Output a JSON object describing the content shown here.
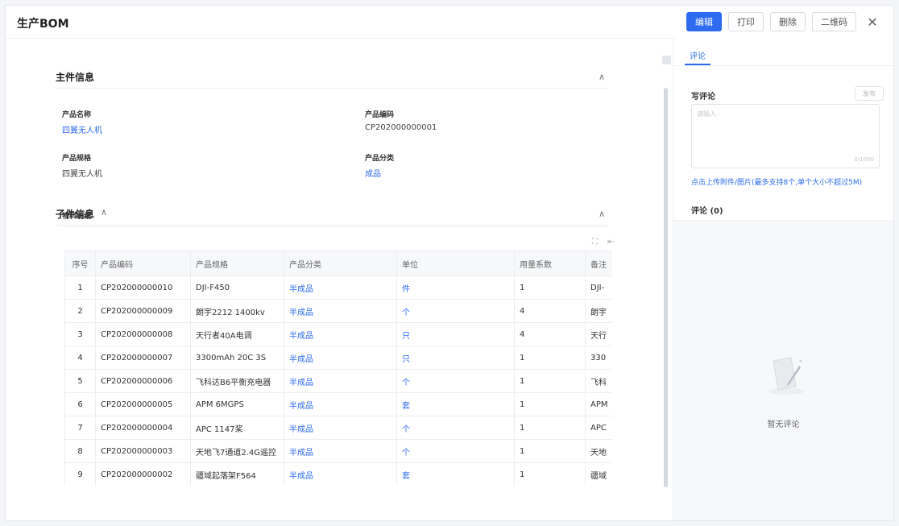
{
  "window": {
    "title": "生产BOM",
    "buttons": {
      "edit": "编辑",
      "print": "打印",
      "delete": "删除",
      "qrcode": "二维码"
    }
  },
  "main_info": {
    "title": "主件信息",
    "fields": {
      "product_name_label": "产品名称",
      "product_name": "四翼无人机",
      "product_code_label": "产品编码",
      "product_code": "CP202000000001",
      "product_spec_label": "产品规格",
      "product_spec": "四翼无人机",
      "product_category_label": "产品分类",
      "product_category": "成品"
    }
  },
  "sub_info": {
    "title": "子件信息",
    "subsection_title": "物料明细",
    "table": {
      "headers": [
        "序号",
        "产品编码",
        "产品规格",
        "产品分类",
        "单位",
        "用量系数",
        "备注"
      ],
      "rows": [
        [
          "1",
          "CP202000000010",
          "DJI-F450",
          "半成品",
          "件",
          "1",
          "DJI-"
        ],
        [
          "2",
          "CP202000000009",
          "朗宇2212 1400kv",
          "半成品",
          "个",
          "4",
          "朗宇"
        ],
        [
          "3",
          "CP202000000008",
          "天行者40A电调",
          "半成品",
          "只",
          "4",
          "天行"
        ],
        [
          "4",
          "CP202000000007",
          "3300mAh 20C 3S",
          "半成品",
          "只",
          "1",
          "330"
        ],
        [
          "5",
          "CP202000000006",
          "飞科达B6平衡充电器",
          "半成品",
          "个",
          "1",
          "飞科"
        ],
        [
          "6",
          "CP202000000005",
          "APM 6MGPS",
          "半成品",
          "套",
          "1",
          "APM"
        ],
        [
          "7",
          "CP202000000004",
          "APC 1147桨",
          "半成品",
          "个",
          "1",
          "APC"
        ],
        [
          "8",
          "CP202000000003",
          "天地飞7通道2.4G遥控",
          "半成品",
          "个",
          "1",
          "天地"
        ],
        [
          "9",
          "CP202000000002",
          "疆域起落架F564",
          "半成品",
          "套",
          "1",
          "疆域"
        ]
      ]
    }
  },
  "sidebar": {
    "tab": "评论",
    "write_title": "写评论",
    "send_label": "发布",
    "input_placeholder": "请输入",
    "char_count": "0/1000",
    "upload_text": "点击上传附件/图片(最多支持8个,单个大小不超过5M)",
    "comments_title": "评论 (0)",
    "empty_text": "暂无评论"
  },
  "colors": {
    "accent": "#2f6bf0"
  }
}
